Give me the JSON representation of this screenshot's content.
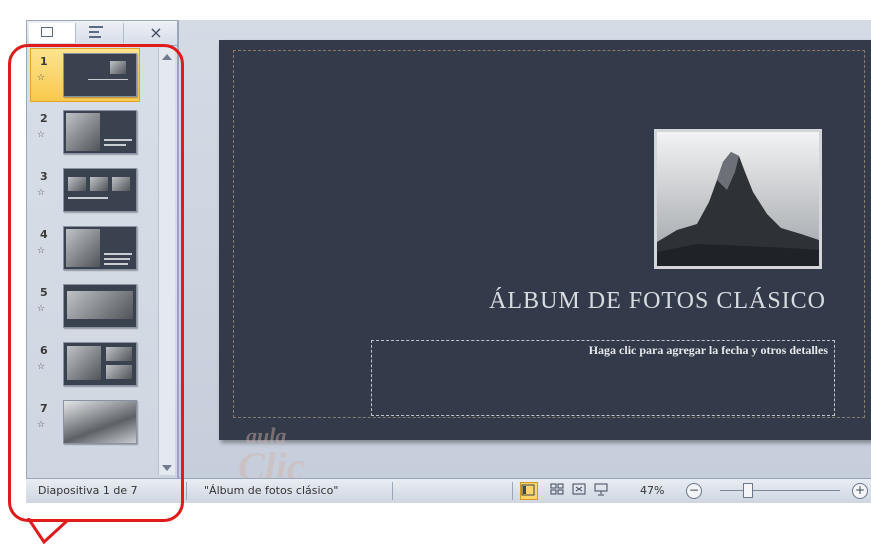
{
  "panel": {
    "close_glyph": "×",
    "slides": [
      {
        "number": "1",
        "selected": true
      },
      {
        "number": "2",
        "selected": false
      },
      {
        "number": "3",
        "selected": false
      },
      {
        "number": "4",
        "selected": false
      },
      {
        "number": "5",
        "selected": false
      },
      {
        "number": "6",
        "selected": false
      },
      {
        "number": "7",
        "selected": false
      }
    ]
  },
  "slide": {
    "title": "ÁLBUM DE FOTOS CLÁSICO",
    "subtitle_placeholder": "Haga clic para  agregar la fecha y otros detalles"
  },
  "watermark": {
    "line1": "aula",
    "line2": "Clic"
  },
  "status": {
    "slide_counter": "Diapositiva 1 de 7",
    "theme_name": "\"Álbum de fotos clásico\"",
    "zoom": "47%",
    "zoom_minus": "−",
    "zoom_plus": "+",
    "zoom_level": 0.47
  },
  "colors": {
    "slide_background": "#333b4a",
    "selection": "#f9c94d",
    "annotation": "#e01b1b"
  },
  "icons": {
    "slides_tab": "slides-tab-icon",
    "outline_tab": "outline-tab-icon",
    "close": "close-icon",
    "animation": "animation-star-icon",
    "normal_view": "normal-view-icon",
    "sorter_view": "slide-sorter-icon",
    "reading_view": "reading-view-icon",
    "slideshow_view": "slideshow-icon"
  }
}
